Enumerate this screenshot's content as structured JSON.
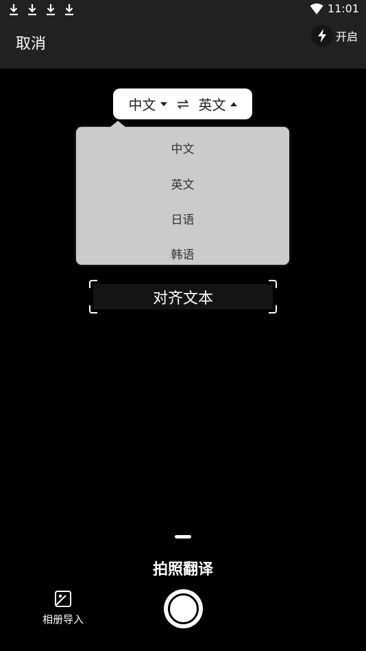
{
  "status_bar": {
    "icons": [
      "download-icon",
      "download-icon",
      "download-icon",
      "download-icon"
    ],
    "wifi": "wifi-icon",
    "time": "11:01"
  },
  "header": {
    "cancel_label": "取消",
    "flash_icon": "flash-icon",
    "flash_label": "开启"
  },
  "language_selector": {
    "source": "中文",
    "target": "英文",
    "swap_icon": "swap-icon"
  },
  "dropdown": {
    "items": [
      "中文",
      "英文",
      "日语",
      "韩语"
    ]
  },
  "align_hint": "对齐文本",
  "bottom": {
    "mode_label": "拍照翻译",
    "album_icon": "image-icon",
    "album_label": "相册导入"
  },
  "colors": {
    "top_bar": "#212121",
    "background": "#000000",
    "dropdown": "#cbcbcb"
  }
}
